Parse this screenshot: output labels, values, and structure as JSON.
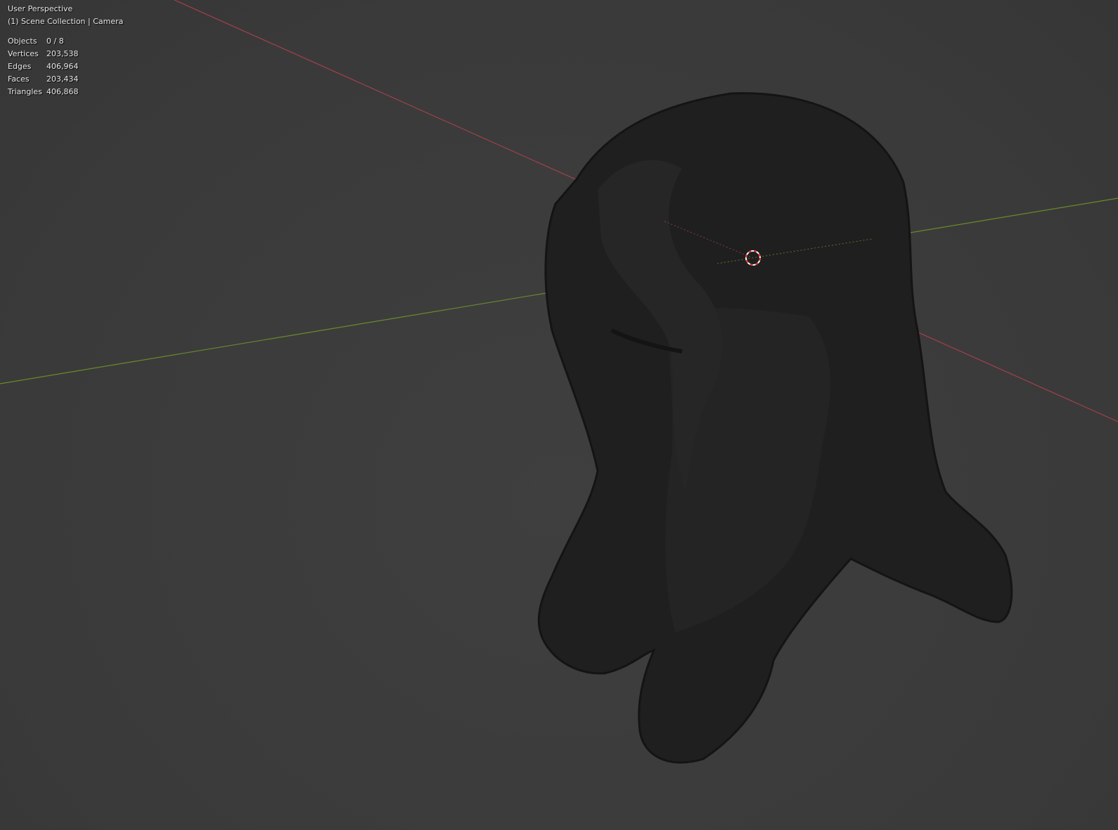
{
  "viewport": {
    "view_name": "User Perspective",
    "collection_info": "(1) Scene Collection | Camera",
    "stats": [
      {
        "label": "Objects",
        "value": "0 / 8"
      },
      {
        "label": "Vertices",
        "value": "203,538"
      },
      {
        "label": "Edges",
        "value": "406,964"
      },
      {
        "label": "Faces",
        "value": "203,434"
      },
      {
        "label": "Triangles",
        "value": "406,868"
      }
    ],
    "colors": {
      "x_axis": "#a0404c",
      "y_axis": "#6a8a2a",
      "mesh": "#1f1f1f",
      "cursor": "#e03030"
    }
  }
}
